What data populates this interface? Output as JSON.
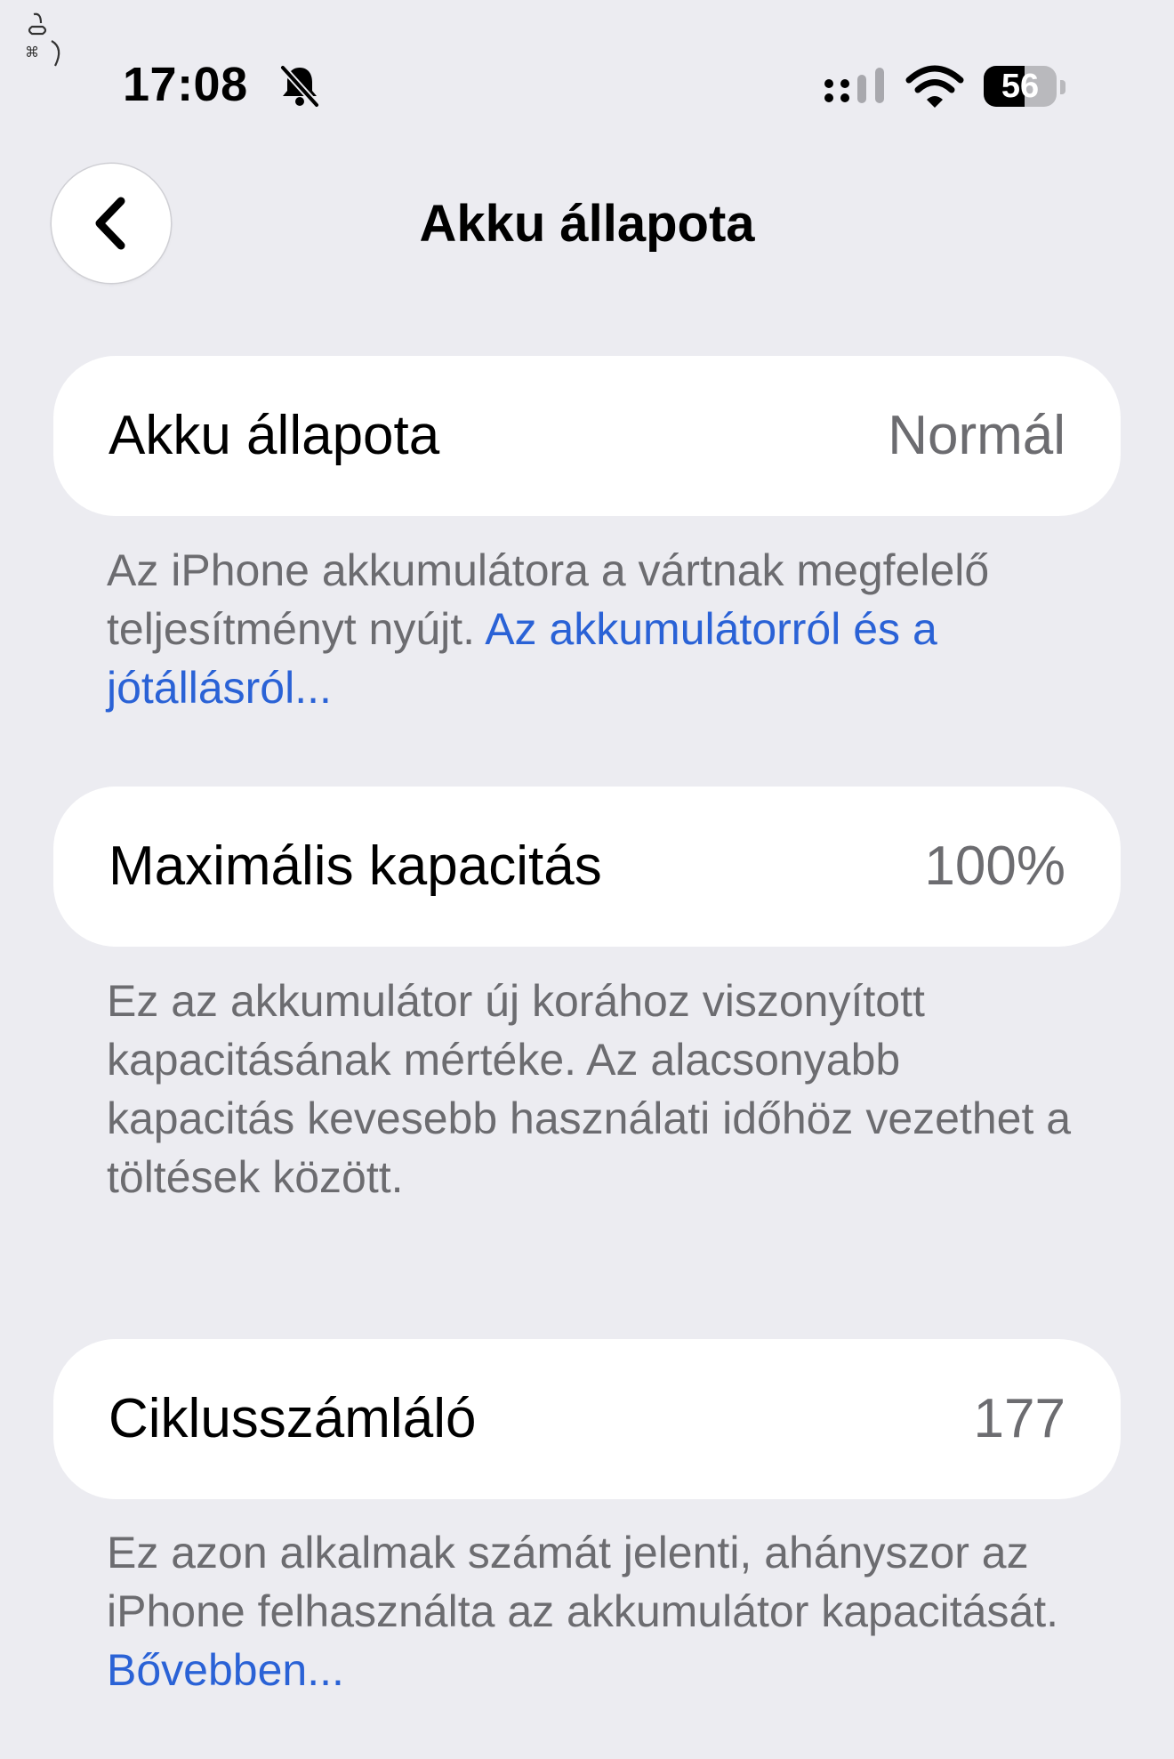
{
  "status_bar": {
    "time": "17:08",
    "battery_level": "56",
    "battery_fraction": 0.56
  },
  "nav": {
    "title": "Akku állapota"
  },
  "rows": [
    {
      "label": "Akku állapota",
      "value": "Normál",
      "footnote": "Az iPhone akkumulátora a vártnak megfelelő teljesítményt nyújt.",
      "link": "Az akkumulátorról és a jótállásról..."
    },
    {
      "label": "Maximális kapacitás",
      "value": "100%",
      "footnote": "Ez az akkumulátor új korához viszonyított kapacitásának mértéke. Az alacsonyabb kapacitás kevesebb használati időhöz vezethet a töltések között."
    },
    {
      "label": "Ciklusszámláló",
      "value": "177",
      "footnote": "Ez azon alkalmak számát jelenti, ahányszor az iPhone felhasználta az akkumulátor kapacitását.",
      "link": "Bővebben..."
    }
  ],
  "icons": {
    "corner": "assistive-touch-icon",
    "silent": "bell-slash-icon",
    "signal": "cellular-signal-icon",
    "wifi": "wifi-icon",
    "back": "chevron-left-icon"
  },
  "colors": {
    "background": "#ececf1",
    "card": "#ffffff",
    "secondary_text": "#6c6c70",
    "link": "#2a62d6"
  }
}
